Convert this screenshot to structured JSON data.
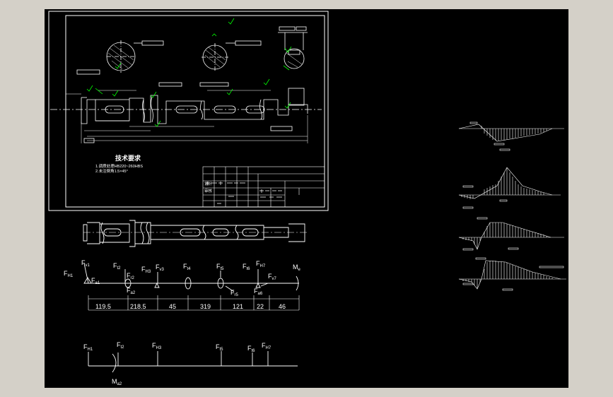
{
  "drawing": {
    "tech_req": {
      "title": "技术要求",
      "line1": "1.调质处理HB220~260HBS",
      "line2": "2.未注倒角1.5×45°"
    },
    "title_block": {
      "rows": [
        [
          "设计",
          "",
          "",
          "",
          "",
          ""
        ],
        [
          "审核",
          "",
          "",
          "",
          "",
          ""
        ],
        [
          "",
          "",
          "",
          "",
          "",
          ""
        ],
        [
          "",
          "",
          "",
          "",
          "",
          ""
        ]
      ]
    }
  },
  "force_diagram": {
    "labels": {
      "FH1": "F",
      "FH1_sub": "H1",
      "Fv1": "F",
      "Fv1_sub": "v1",
      "Fa1": "F",
      "Fa1_sub": "a1",
      "Ft2": "F",
      "Ft2_sub": "t2",
      "Fr2": "F",
      "Fr2_sub": "r2",
      "Fa2": "F",
      "Fa2_sub": "a2",
      "FH3": "F",
      "FH3_sub": "H3",
      "Fv3": "F",
      "Fv3_sub": "v3",
      "Ft4": "F",
      "Ft4_sub": "t4",
      "Ft5": "F",
      "Ft5_sub": "t5",
      "Fr5": "F",
      "Fr5_sub": "r5",
      "Ft6": "F",
      "Ft6_sub": "t6",
      "FH7": "F",
      "FH7_sub": "H7",
      "Fa6": "F",
      "Fa6_sub": "a6",
      "Fv7": "F",
      "Fv7_sub": "v7",
      "Me": "M",
      "Me_sub": "e"
    },
    "dimensions": [
      "119.5",
      "218.5",
      "45",
      "319",
      "121",
      "22",
      "46"
    ]
  },
  "horizontal_diagram": {
    "labels": {
      "FH1": "F",
      "FH1_sub": "H1",
      "Ft2": "F",
      "Ft2_sub": "t2",
      "FH3": "F",
      "FH3_sub": "H3",
      "Ft5": "F",
      "Ft5_sub": "t5",
      "Ft6": "F",
      "Ft6_sub": "t6",
      "FH7": "F",
      "FH7_sub": "H7",
      "Ma2": "M",
      "Ma2_sub": "a2"
    }
  },
  "colors": {
    "background": "#000000",
    "line": "#ffffff",
    "annotation": "#00ff00",
    "frame": "#d4d0c8"
  }
}
